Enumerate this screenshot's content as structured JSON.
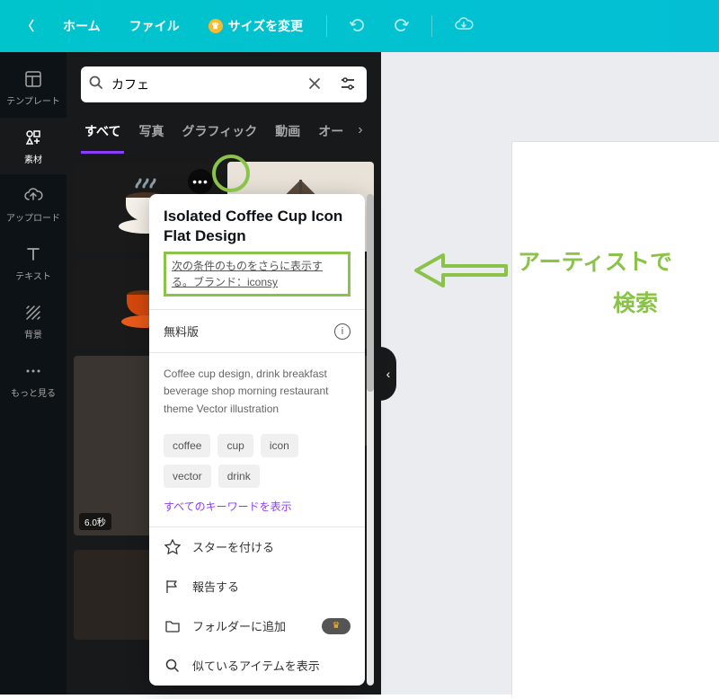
{
  "topbar": {
    "home": "ホーム",
    "file": "ファイル",
    "resize": "サイズを変更"
  },
  "sidebar": {
    "items": [
      {
        "label": "テンプレート"
      },
      {
        "label": "素材"
      },
      {
        "label": "アップロード"
      },
      {
        "label": "テキスト"
      },
      {
        "label": "背景"
      },
      {
        "label": "もっと見る"
      }
    ]
  },
  "search": {
    "value": "カフェ"
  },
  "tabs": {
    "items": [
      {
        "label": "すべて",
        "active": true
      },
      {
        "label": "写真"
      },
      {
        "label": "グラフィック"
      },
      {
        "label": "動画"
      },
      {
        "label": "オー"
      }
    ]
  },
  "results": {
    "duration": "6.0秒"
  },
  "popover": {
    "title": "Isolated Coffee Cup Icon Flat Design",
    "artist_link": "次の条件のものをさらに表示する。ブランド：iconsy",
    "plan": "無料版",
    "description": "Coffee cup design, drink breakfast beverage shop morning restaurant theme Vector illustration",
    "tags": [
      "coffee",
      "cup",
      "icon",
      "vector",
      "drink"
    ],
    "show_all": "すべてのキーワードを表示",
    "actions": {
      "star": "スターを付ける",
      "report": "報告する",
      "folder": "フォルダーに追加",
      "similar": "似ているアイテムを表示"
    }
  },
  "annotation": {
    "text1": "アーティストで",
    "text2": "検索"
  }
}
